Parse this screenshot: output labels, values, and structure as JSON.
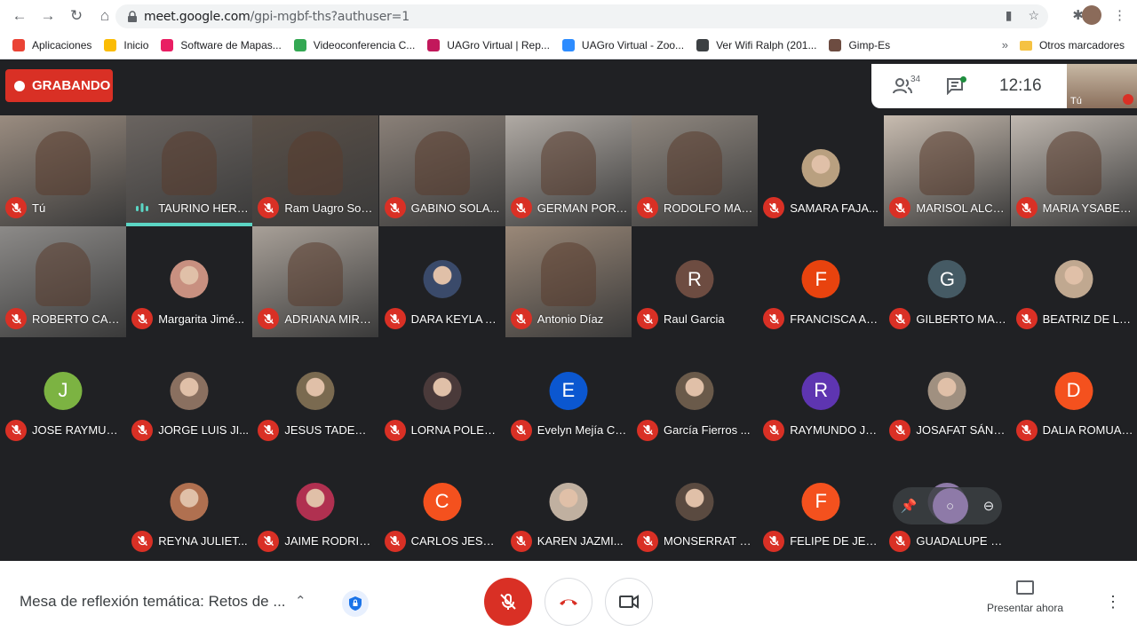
{
  "browser": {
    "url_host": "meet.google.com",
    "url_path": "/gpi-mgbf-ths?authuser=1",
    "bookmarks": [
      {
        "label": "Aplicaciones",
        "color": "#ea4335"
      },
      {
        "label": "Inicio",
        "color": "#fbbc04"
      },
      {
        "label": "Software de Mapas...",
        "color": "#e91e63"
      },
      {
        "label": "Videoconferencia C...",
        "color": "#34a853"
      },
      {
        "label": "UAGro Virtual | Rep...",
        "color": "#c2185b"
      },
      {
        "label": "UAGro Virtual - Zoo...",
        "color": "#2d8cff"
      },
      {
        "label": "Ver Wifi Ralph (201...",
        "color": "#3c4043"
      },
      {
        "label": "Gimp-Es",
        "color": "#6d4c41"
      }
    ],
    "more_bookmarks": "»",
    "other_bookmarks": "Otros marcadores"
  },
  "meet": {
    "recording_label": "GRABANDO",
    "participants_count": "34",
    "time": "12:16",
    "self_label": "Tú",
    "tiles": [
      {
        "name": "Tú",
        "type": "video",
        "bg": "#9a8c80"
      },
      {
        "name": "TAURINO HERN...",
        "type": "video",
        "bg": "#6a6460",
        "speaking": true
      },
      {
        "name": "Ram Uagro Soc...",
        "type": "video",
        "bg": "#5a5048"
      },
      {
        "name": "GABINO SOLA...",
        "type": "video",
        "bg": "#8a8078"
      },
      {
        "name": "GERMAN PORT...",
        "type": "video",
        "bg": "#b0aaa4"
      },
      {
        "name": "RODOLFO MAU...",
        "type": "video",
        "bg": "#908880"
      },
      {
        "name": "SAMARA FAJA...",
        "type": "photo",
        "color": "#b9a080"
      },
      {
        "name": "MARISOL ALCO...",
        "type": "video",
        "bg": "#c8bcb0"
      },
      {
        "name": "MARIA YSABEL...",
        "type": "video",
        "bg": "#c0b8b0"
      },
      {
        "name": "ROBERTO CAÑ...",
        "type": "video",
        "bg": "#8c8a88"
      },
      {
        "name": "Margarita Jimé...",
        "type": "photo",
        "color": "#c89080"
      },
      {
        "name": "ADRIANA MIRA...",
        "type": "video",
        "bg": "#a8a098"
      },
      {
        "name": "DARA KEYLA A...",
        "type": "photo",
        "color": "#3a4a6a"
      },
      {
        "name": "Antonio Díaz",
        "type": "video",
        "bg": "#9a8878"
      },
      {
        "name": "Raul Garcia",
        "type": "letter",
        "letter": "R",
        "color": "#6d4c41"
      },
      {
        "name": "FRANCISCA AL...",
        "type": "letter",
        "letter": "F",
        "color": "#e8430e"
      },
      {
        "name": "GILBERTO MAR...",
        "type": "letter",
        "letter": "G",
        "color": "#455a64"
      },
      {
        "name": "BEATRIZ DE LO...",
        "type": "photo",
        "color": "#c0a890"
      },
      {
        "name": "JOSE RAYMUN...",
        "type": "letter",
        "letter": "J",
        "color": "#7cb342"
      },
      {
        "name": "JORGE LUIS JI...",
        "type": "photo",
        "color": "#8a7060"
      },
      {
        "name": "JESUS TADEO ...",
        "type": "photo",
        "color": "#7a6a50"
      },
      {
        "name": "LORNA POLET ...",
        "type": "photo",
        "color": "#4a3a3a"
      },
      {
        "name": "Evelyn Mejía Ca...",
        "type": "letter",
        "letter": "E",
        "color": "#0b57d0"
      },
      {
        "name": "García Fierros ...",
        "type": "photo",
        "color": "#6a5a4a"
      },
      {
        "name": "RAYMUNDO JU...",
        "type": "letter",
        "letter": "R",
        "color": "#5e35b1"
      },
      {
        "name": "JOSAFAT SÁNC...",
        "type": "photo",
        "color": "#a09080"
      },
      {
        "name": "DALIA ROMUAL...",
        "type": "letter",
        "letter": "D",
        "color": "#f4511e"
      },
      {
        "name": "REYNA JULIET...",
        "type": "photo",
        "color": "#b07050"
      },
      {
        "name": "JAIME RODRIG...",
        "type": "photo",
        "color": "#b03050"
      },
      {
        "name": "CARLOS JESUS...",
        "type": "letter",
        "letter": "C",
        "color": "#f4511e"
      },
      {
        "name": "KAREN JAZMI...",
        "type": "photo",
        "color": "#c0b0a0"
      },
      {
        "name": "MONSERRAT M...",
        "type": "photo",
        "color": "#5a4a40"
      },
      {
        "name": "FELIPE DE JES...",
        "type": "letter",
        "letter": "F",
        "color": "#f4511e"
      },
      {
        "name": "GUADALUPE JE...",
        "type": "photo",
        "color": "#8e7aa8"
      }
    ]
  },
  "bottom": {
    "meeting_title": "Mesa de reflexión temática: Retos de ...",
    "present_label": "Presentar ahora"
  }
}
